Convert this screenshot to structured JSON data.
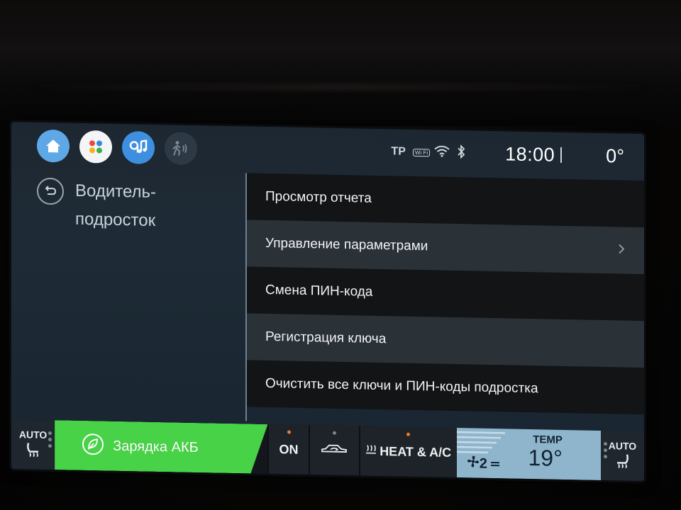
{
  "status": {
    "tp": "TP",
    "wifi_label": "Wi Fi",
    "time": "18:00",
    "outside_temp": "0°"
  },
  "apps": [
    {
      "icon": "home-icon"
    },
    {
      "icon": "apps-grid-icon"
    },
    {
      "icon": "media-icon"
    },
    {
      "icon": "pedestrian-alert-icon"
    }
  ],
  "page": {
    "title": "Водитель-подросток"
  },
  "menu": {
    "items": [
      {
        "label": "Просмотр отчета"
      },
      {
        "label": "Управление параметрами"
      },
      {
        "label": "Смена ПИН-кода"
      },
      {
        "label": "Регистрация ключа"
      },
      {
        "label": "Очистить все ключи и ПИН-коды подростка"
      }
    ]
  },
  "climate": {
    "seat_left": "AUTO",
    "charge": "Зарядка АКБ",
    "on": "ON",
    "heat_ac": "HEAT & A/C",
    "fan_speed": "2",
    "temp_label": "TEMP",
    "temp_value": "19°",
    "seat_right": "AUTO"
  },
  "colors": {
    "charge_green": "#47d247",
    "temp_blue": "#8fb5cc",
    "indicator_orange": "#f07a2a"
  }
}
